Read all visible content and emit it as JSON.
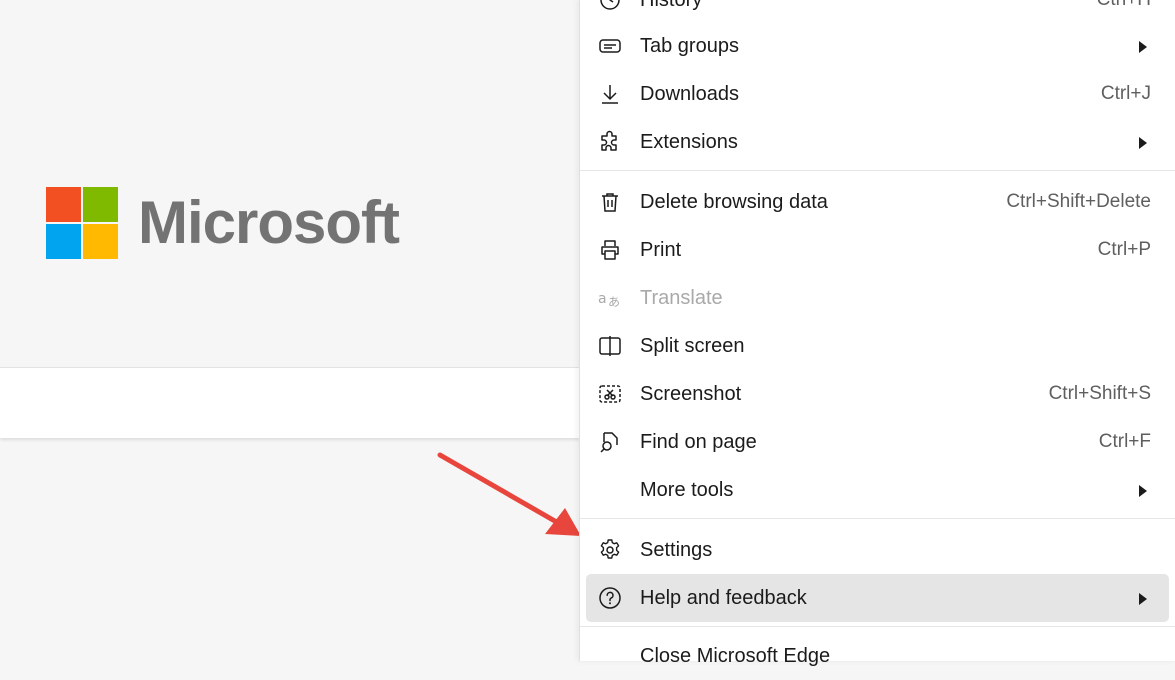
{
  "logo": {
    "word": "Microsoft",
    "colors": [
      "#f25022",
      "#7fba00",
      "#00a4ef",
      "#ffb900"
    ]
  },
  "annotation": {
    "color": "#e8463c"
  },
  "menu": {
    "history": {
      "label": "History",
      "shortcut": "Ctrl+H",
      "icon": "history-icon"
    },
    "tab_groups": {
      "label": "Tab groups",
      "icon": "tab-groups-icon"
    },
    "downloads": {
      "label": "Downloads",
      "shortcut": "Ctrl+J",
      "icon": "download-icon"
    },
    "extensions": {
      "label": "Extensions",
      "icon": "puzzle-icon"
    },
    "delete_browsing": {
      "label": "Delete browsing data",
      "shortcut": "Ctrl+Shift+Delete",
      "icon": "trash-icon"
    },
    "print": {
      "label": "Print",
      "shortcut": "Ctrl+P",
      "icon": "printer-icon"
    },
    "translate": {
      "label": "Translate",
      "icon": "translate-icon",
      "disabled": true
    },
    "split_screen": {
      "label": "Split screen",
      "icon": "split-screen-icon"
    },
    "screenshot": {
      "label": "Screenshot",
      "shortcut": "Ctrl+Shift+S",
      "icon": "screenshot-icon"
    },
    "find_on_page": {
      "label": "Find on page",
      "shortcut": "Ctrl+F",
      "icon": "find-icon"
    },
    "more_tools": {
      "label": "More tools"
    },
    "settings": {
      "label": "Settings",
      "icon": "gear-icon"
    },
    "help": {
      "label": "Help and feedback",
      "icon": "help-icon",
      "highlighted": true
    },
    "close_edge": {
      "label": "Close Microsoft Edge"
    }
  }
}
